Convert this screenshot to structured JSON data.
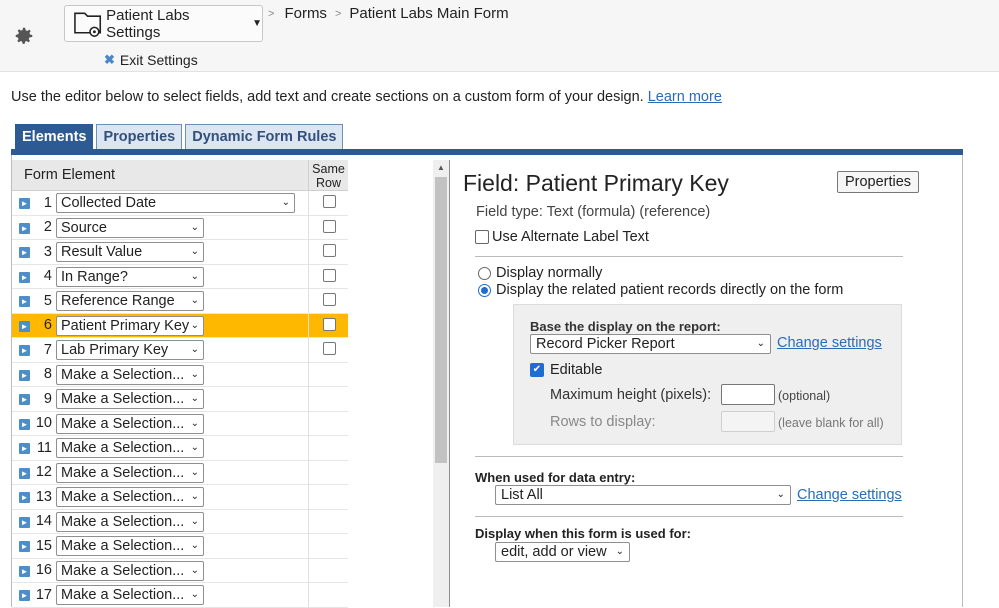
{
  "header": {
    "settings_button_label": "Patient Labs Settings",
    "exit_settings_label": "Exit Settings",
    "breadcrumb": [
      "Forms",
      "Patient Labs Main Form"
    ]
  },
  "intro": {
    "text": "Use the editor below to select fields, add text and create sections on a custom form of your design.",
    "link": "Learn more"
  },
  "tabs": [
    {
      "label": "Elements",
      "active": true
    },
    {
      "label": "Properties",
      "active": false
    },
    {
      "label": "Dynamic Form Rules",
      "active": false
    }
  ],
  "elements_table": {
    "col_form_element": "Form Element",
    "col_same_row_1": "Same",
    "col_same_row_2": "Row",
    "rows": [
      {
        "num": "1",
        "value": "Collected Date",
        "checkbox": true
      },
      {
        "num": "2",
        "value": "Source",
        "checkbox": true
      },
      {
        "num": "3",
        "value": "Result Value",
        "checkbox": true
      },
      {
        "num": "4",
        "value": "In Range?",
        "checkbox": true
      },
      {
        "num": "5",
        "value": "Reference Range",
        "checkbox": true
      },
      {
        "num": "6",
        "value": "Patient Primary Key",
        "checkbox": true,
        "selected": true
      },
      {
        "num": "7",
        "value": "Lab Primary Key",
        "checkbox": true
      },
      {
        "num": "8",
        "value": "Make a Selection...",
        "checkbox": false
      },
      {
        "num": "9",
        "value": "Make a Selection...",
        "checkbox": false
      },
      {
        "num": "10",
        "value": "Make a Selection...",
        "checkbox": false
      },
      {
        "num": "11",
        "value": "Make a Selection...",
        "checkbox": false
      },
      {
        "num": "12",
        "value": "Make a Selection...",
        "checkbox": false
      },
      {
        "num": "13",
        "value": "Make a Selection...",
        "checkbox": false
      },
      {
        "num": "14",
        "value": "Make a Selection...",
        "checkbox": false
      },
      {
        "num": "15",
        "value": "Make a Selection...",
        "checkbox": false
      },
      {
        "num": "16",
        "value": "Make a Selection...",
        "checkbox": false
      },
      {
        "num": "17",
        "value": "Make a Selection...",
        "checkbox": false
      }
    ]
  },
  "field_panel": {
    "title": "Field: Patient Primary Key",
    "properties_button": "Properties",
    "field_type": "Field type: Text (formula) (reference)",
    "alt_label": "Use Alternate Label Text",
    "radio_normal": "Display normally",
    "radio_related": "Display the related patient records directly on the form",
    "base_display_header": "Base the display on the report:",
    "report_value": "Record Picker Report",
    "change_settings": "Change settings",
    "editable_label": "Editable",
    "max_height_label": "Maximum height (pixels):",
    "max_height_note": "(optional)",
    "rows_label": "Rows to display:",
    "rows_note": "(leave blank for all)",
    "data_entry_header": "When used for data entry:",
    "data_entry_value": "List All",
    "data_entry_change": "Change settings",
    "display_when_header": "Display when this form is used for:",
    "display_when_value": "edit, add or view"
  }
}
